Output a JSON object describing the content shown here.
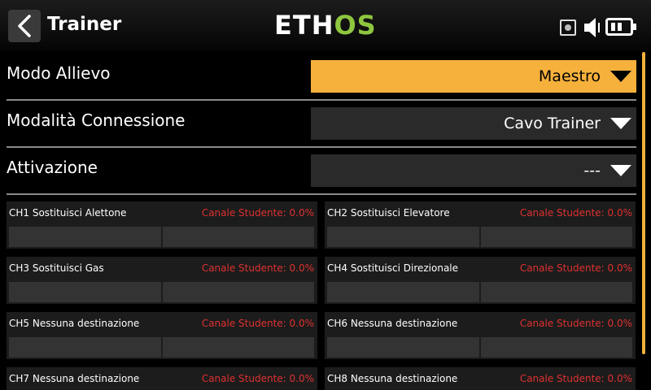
{
  "header": {
    "title": "Trainer",
    "logo_main": "ETH",
    "logo_accent": "OS"
  },
  "colors": {
    "accent": "#f6b13c",
    "logo_green": "#8ec63f",
    "student_red": "#e03030"
  },
  "settings": [
    {
      "label": "Modo Allievo",
      "value": "Maestro",
      "active": true
    },
    {
      "label": "Modalità Connessione",
      "value": "Cavo Trainer",
      "active": false
    },
    {
      "label": "Attivazione",
      "value": "---",
      "active": false
    }
  ],
  "channels": [
    {
      "name": "CH1  Sostituisci Alettone",
      "student": "Canale Studente: 0.0%"
    },
    {
      "name": "CH2  Sostituisci Elevatore",
      "student": "Canale Studente: 0.0%"
    },
    {
      "name": "CH3  Sostituisci Gas",
      "student": "Canale Studente: 0.0%"
    },
    {
      "name": "CH4  Sostituisci Direzionale",
      "student": "Canale Studente: 0.0%"
    },
    {
      "name": "CH5  Nessuna destinazione",
      "student": "Canale Studente: 0.0%"
    },
    {
      "name": "CH6  Nessuna destinazione",
      "student": "Canale Studente: 0.0%"
    },
    {
      "name": "CH7  Nessuna destinazione",
      "student": "Canale Studente: 0.0%"
    },
    {
      "name": "CH8  Nessuna destinazione",
      "student": "Canale Studente: 0.0%"
    }
  ],
  "icons": {
    "back": "chevron-left-icon",
    "record": "record-icon",
    "volume": "speaker-icon",
    "battery": "battery-icon",
    "dropdown": "triangle-down-icon"
  }
}
